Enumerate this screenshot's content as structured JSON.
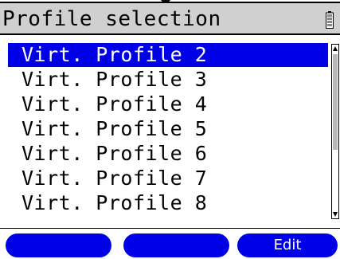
{
  "header": {
    "title": "Profile selection",
    "battery_icon": "battery-icon"
  },
  "list": {
    "items": [
      {
        "label": "Virt. Profile 2",
        "selected": true
      },
      {
        "label": "Virt. Profile 3",
        "selected": false
      },
      {
        "label": "Virt. Profile 4",
        "selected": false
      },
      {
        "label": "Virt. Profile 5",
        "selected": false
      },
      {
        "label": "Virt. Profile 6",
        "selected": false
      },
      {
        "label": "Virt. Profile 7",
        "selected": false
      },
      {
        "label": "Virt. Profile 8",
        "selected": false
      }
    ]
  },
  "softkeys": {
    "left_label": "",
    "middle_label": "",
    "right_label": "Edit"
  },
  "colors": {
    "highlight": "#0000e6",
    "header_bg": "#d0d0d0"
  }
}
